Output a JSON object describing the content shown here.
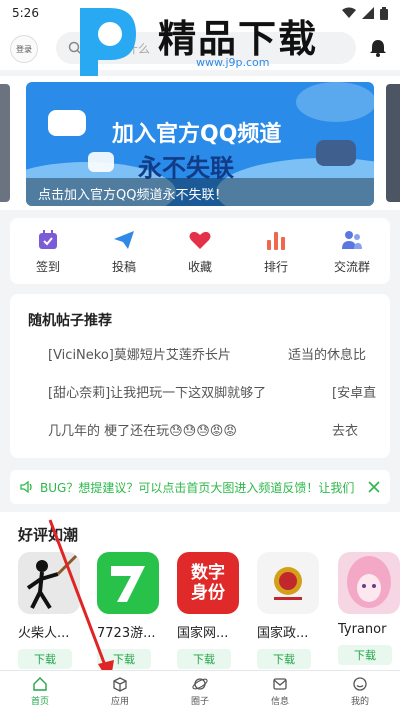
{
  "status": {
    "time": "5:26"
  },
  "header": {
    "login_label": "登录",
    "search_placeholder": "想搜索什么"
  },
  "watermark": {
    "title": "精品下载",
    "url": "www.j9p.com"
  },
  "banner": {
    "title_line1": "加入官方QQ频道",
    "title_line2": "永不失联",
    "caption": "点击加入官方QQ频道永不失联！"
  },
  "quicknav": [
    {
      "label": "签到",
      "icon": "calendar-icon",
      "color": "#7c5cd6"
    },
    {
      "label": "投稿",
      "icon": "paper-plane-icon",
      "color": "#2f8ae6"
    },
    {
      "label": "收藏",
      "icon": "heart-icon",
      "color": "#e5304a"
    },
    {
      "label": "排行",
      "icon": "bar-chart-icon",
      "color": "#f0674b"
    },
    {
      "label": "交流群",
      "icon": "group-icon",
      "color": "#5b78e0"
    }
  ],
  "recommend": {
    "title": "随机帖子推荐",
    "row1_a": "[ViciNeko]莫娜短片艾莲乔长片",
    "row1_b": "适当的休息比",
    "row2_a": "[甜心奈莉]让我把玩一下这双脚就够了",
    "row2_b": "[安卓直",
    "row3_a": "几几年的 梗了还在玩😓😓😓😡😡",
    "row3_b": "去衣"
  },
  "notice": {
    "text": "BUG？想提建议？可以点击首页大图进入频道反馈！让我们"
  },
  "good": {
    "title": "好评如潮",
    "apps": [
      {
        "name": "火柴人...",
        "download": "下载"
      },
      {
        "name": "7723游...",
        "download": "下载"
      },
      {
        "name": "国家网...",
        "download": "下载",
        "icon_text": "数字身份"
      },
      {
        "name": "国家政...",
        "download": "下载"
      },
      {
        "name": "Tyranor",
        "download": "下载"
      }
    ]
  },
  "tabs": [
    {
      "label": "首页",
      "active": true
    },
    {
      "label": "应用",
      "active": false
    },
    {
      "label": "圈子",
      "active": false
    },
    {
      "label": "信息",
      "active": false
    },
    {
      "label": "我的",
      "active": false
    }
  ]
}
